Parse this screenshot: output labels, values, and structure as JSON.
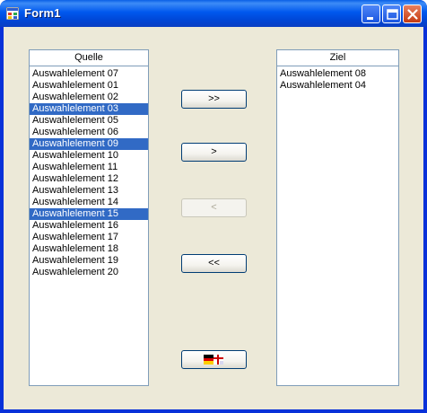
{
  "window": {
    "title": "Form1"
  },
  "source": {
    "header": "Quelle",
    "items": [
      {
        "label": "Auswahlelement 07",
        "selected": false
      },
      {
        "label": "Auswahlelement 01",
        "selected": false
      },
      {
        "label": "Auswahlelement 02",
        "selected": false
      },
      {
        "label": "Auswahlelement 03",
        "selected": true
      },
      {
        "label": "Auswahlelement 05",
        "selected": false
      },
      {
        "label": "Auswahlelement 06",
        "selected": false
      },
      {
        "label": "Auswahlelement 09",
        "selected": true
      },
      {
        "label": "Auswahlelement 10",
        "selected": false
      },
      {
        "label": "Auswahlelement 11",
        "selected": false
      },
      {
        "label": "Auswahlelement 12",
        "selected": false
      },
      {
        "label": "Auswahlelement 13",
        "selected": false
      },
      {
        "label": "Auswahlelement 14",
        "selected": false
      },
      {
        "label": "Auswahlelement 15",
        "selected": true
      },
      {
        "label": "Auswahlelement 16",
        "selected": false
      },
      {
        "label": "Auswahlelement 17",
        "selected": false
      },
      {
        "label": "Auswahlelement 18",
        "selected": false
      },
      {
        "label": "Auswahlelement 19",
        "selected": false
      },
      {
        "label": "Auswahlelement 20",
        "selected": false
      }
    ]
  },
  "target": {
    "header": "Ziel",
    "items": [
      {
        "label": "Auswahlelement 08",
        "selected": false
      },
      {
        "label": "Auswahlelement 04",
        "selected": false
      }
    ]
  },
  "buttons": {
    "move_all_right": ">>",
    "move_right": ">",
    "move_left": "<",
    "move_all_left": "<<",
    "language_icon": "german-flag-icon"
  },
  "colors": {
    "selection": "#316ac5",
    "face": "#ece9d8",
    "titlebar": "#0058ee"
  }
}
